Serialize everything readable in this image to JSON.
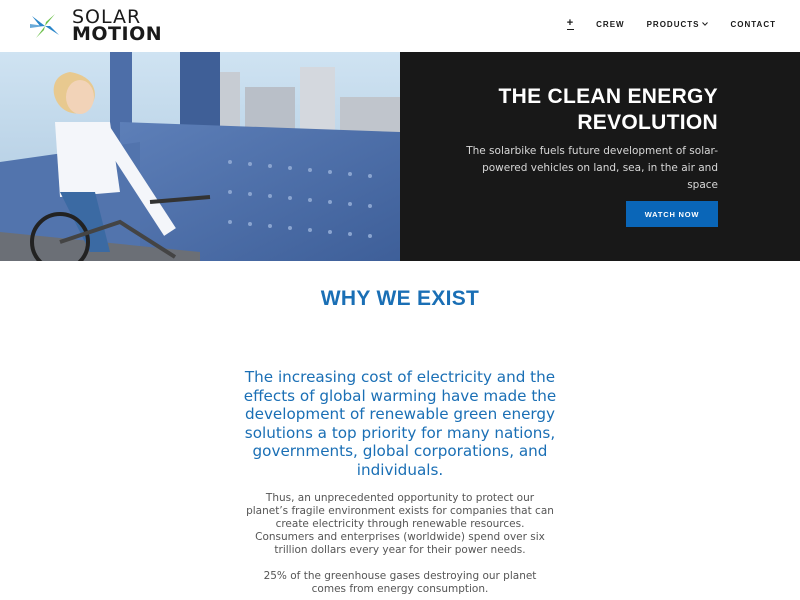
{
  "brand": {
    "line1": "SOLAR",
    "line2": "MOTION",
    "colors": {
      "blue": "#2a86c9",
      "green": "#6cc04a",
      "text": "#1a1a1a"
    }
  },
  "nav": {
    "items": [
      {
        "label": "+",
        "icon": "plus-icon"
      },
      {
        "label": "CREW"
      },
      {
        "label": "PRODUCTS",
        "icon": "chevron-down-icon"
      },
      {
        "label": "CONTACT"
      }
    ]
  },
  "hero": {
    "title": "THE CLEAN ENERGY REVOLUTION",
    "subtitle": "The solarbike fuels future development of solar-powered vehicles on land, sea, in the air and space",
    "button_label": "WATCH NOW",
    "panel_color": "#181818",
    "button_color": "#0a66b8"
  },
  "why": {
    "title": "WHY WE EXIST",
    "lead": "The increasing cost of electricity and the effects of global warming have made the development of renewable green energy solutions a top priority for many nations, governments, global corporations, and individuals.",
    "paragraphs": [
      "Thus, an unprecedented opportunity to protect our planet’s fragile environment exists for companies that can create electricity through renewable resources. Consumers and enterprises (worldwide) spend over six trillion dollars every year for their power needs.",
      "25% of the greenhouse gases destroying our planet comes from energy consumption."
    ],
    "accent_color": "#1a6fb5"
  }
}
